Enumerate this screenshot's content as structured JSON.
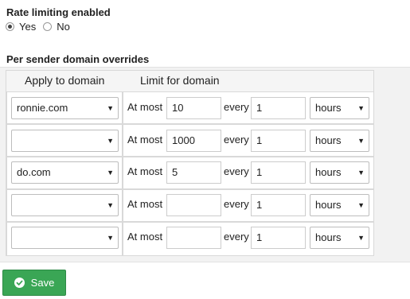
{
  "rate_limiting": {
    "title": "Rate limiting enabled",
    "options": [
      {
        "label": "Yes",
        "checked": true
      },
      {
        "label": "No",
        "checked": false
      }
    ]
  },
  "overrides": {
    "title": "Per sender domain overrides",
    "headers": {
      "domain": "Apply to domain",
      "limit": "Limit for domain"
    },
    "at_most_label": "At most",
    "every_label": "every",
    "rows": [
      {
        "domain": "ronnie.com",
        "limit": "10",
        "every": "1",
        "unit": "hours"
      },
      {
        "domain": "",
        "limit": "1000",
        "every": "1",
        "unit": "hours"
      },
      {
        "domain": "do.com",
        "limit": "5",
        "every": "1",
        "unit": "hours"
      },
      {
        "domain": "",
        "limit": "",
        "every": "1",
        "unit": "hours"
      },
      {
        "domain": "",
        "limit": "",
        "every": "1",
        "unit": "hours"
      }
    ]
  },
  "save": {
    "label": "Save",
    "icon": "check-circle-icon",
    "color": "#3aa655"
  }
}
